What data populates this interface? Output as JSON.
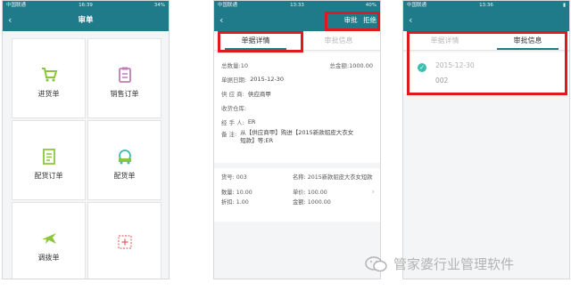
{
  "phone1": {
    "status": {
      "carrier": "中国联通",
      "time": "16:39",
      "battery": "34%"
    },
    "nav": {
      "back": "‹",
      "title": "审单"
    },
    "grid": [
      {
        "label": "进货单",
        "icon": "cart-icon"
      },
      {
        "label": "销售订单",
        "icon": "clipboard-icon"
      },
      {
        "label": "配货订单",
        "icon": "document-icon"
      },
      {
        "label": "配货单",
        "icon": "delivery-icon"
      },
      {
        "label": "调拨单",
        "icon": "airplane-icon"
      },
      {
        "label": "",
        "icon": "add-icon"
      }
    ]
  },
  "phone2": {
    "status": {
      "carrier": "中国联通",
      "time": "13:33",
      "battery": "40%"
    },
    "nav": {
      "back": "‹",
      "approve": "审批",
      "reject": "拒绝"
    },
    "tabs": [
      "单据详情",
      "审批信息"
    ],
    "detail": {
      "total_qty_k": "总数量:",
      "total_qty_v": "10",
      "total_amt_k": "总金额:",
      "total_amt_v": "1000.00",
      "date_k": "单据日期:",
      "date_v": "2015-12-30",
      "supplier_k": "供 应 商:",
      "supplier_v": "供应商甲",
      "warehouse_k": "收货仓库:",
      "warehouse_v": "",
      "handler_k": "经 手 人:",
      "handler_v": "ER",
      "note_k": "备     注:",
      "note_v": "从【供应商甲】购进【2015新款貂皮大衣女短款】等;ER"
    },
    "lines": {
      "code_k": "货号:",
      "code_v": "003",
      "name_k": "名称:",
      "name_v": "2015新款貂皮大衣女短款",
      "qty_k": "数量:",
      "qty_v": "10.00",
      "price_k": "单价:",
      "price_v": "100.00",
      "discount_k": "折扣:",
      "discount_v": "1.00",
      "amount_k": "金额:",
      "amount_v": "1000.00",
      "chevron": "›"
    }
  },
  "phone3": {
    "status": {
      "carrier": "中国联通",
      "time": "13:36",
      "battery": ""
    },
    "nav": {
      "back": "‹"
    },
    "tabs": [
      "单据详情",
      "审批信息"
    ],
    "record": {
      "check": "✓",
      "date": "2015-12-30",
      "code": "002"
    }
  },
  "watermark": {
    "text": "管家婆行业管理软件",
    "icon": "wechat-icon"
  },
  "colors": {
    "nav": "#1f7a8a",
    "highlight": "#e0191f",
    "check": "#3bbdb0"
  }
}
